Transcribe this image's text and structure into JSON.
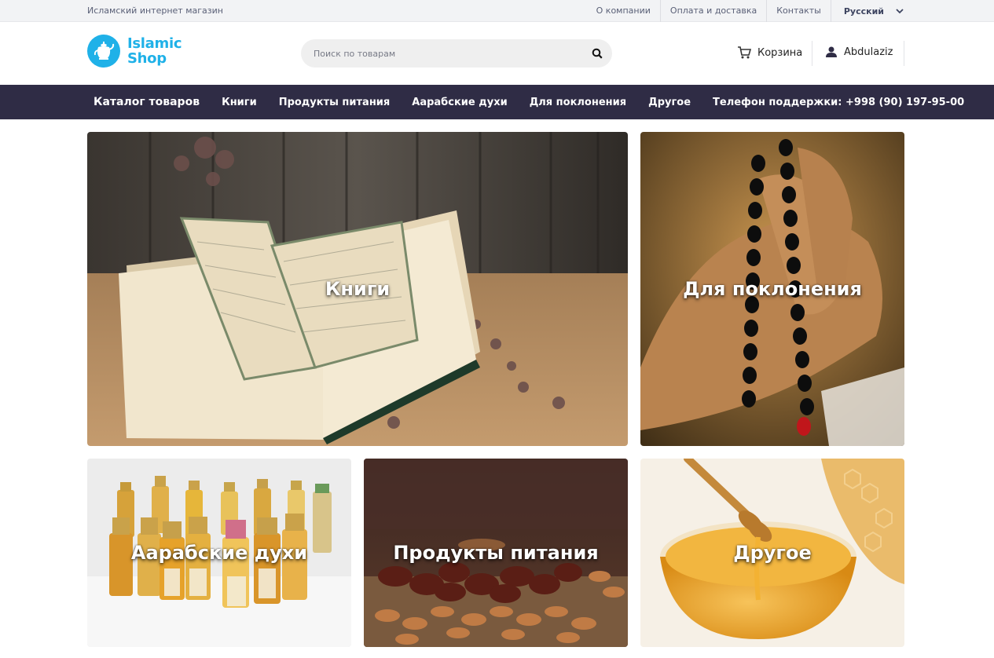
{
  "topbar": {
    "tagline": "Исламский интернет магазин",
    "links": [
      "О компании",
      "Оплата и доставка",
      "Контакты"
    ],
    "language": "Русский"
  },
  "header": {
    "logo": {
      "line1": "Islamic",
      "line2": "Shop",
      "icon": "teapot-icon"
    },
    "search": {
      "placeholder": "Поиск по товарам",
      "value": ""
    },
    "cart_label": "Корзина",
    "user_name": "Abdulaziz"
  },
  "nav": {
    "catalog": "Каталог товаров",
    "items": [
      "Книги",
      "Продукты питания",
      "Аарабские духи",
      "Для поклонения",
      "Другое"
    ],
    "phone": "Телефон поддержки: +998 (90) 197-95-00"
  },
  "tiles": [
    {
      "label": "Книги",
      "image": "open-quran-book"
    },
    {
      "label": "Для поклонения",
      "image": "hand-with-prayer-beads"
    },
    {
      "label": "Аарабские духи",
      "image": "perfume-bottles"
    },
    {
      "label": "Продукты питания",
      "image": "dates-and-almonds"
    },
    {
      "label": "Другое",
      "image": "honey-bowl"
    }
  ],
  "colors": {
    "brand": "#1fb1e8",
    "nav_bg": "#2f2c45",
    "topbar_bg": "#f2f3f5"
  }
}
